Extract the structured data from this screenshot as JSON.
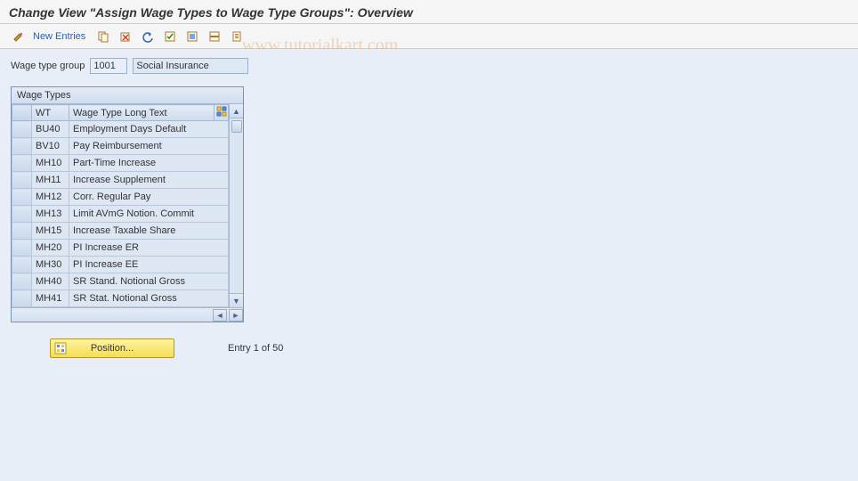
{
  "title": "Change View \"Assign Wage Types to Wage Type Groups\": Overview",
  "toolbar": {
    "new_entries": "New Entries"
  },
  "form": {
    "wage_type_group_label": "Wage type group",
    "wage_type_group_code": "1001",
    "wage_type_group_text": "Social Insurance"
  },
  "table": {
    "title": "Wage Types",
    "col_wt": "WT",
    "col_longtext": "Wage Type Long Text",
    "rows": [
      {
        "wt": "BU40",
        "text": "Employment Days Default"
      },
      {
        "wt": "BV10",
        "text": "Pay Reimbursement"
      },
      {
        "wt": "MH10",
        "text": "Part-Time Increase"
      },
      {
        "wt": "MH11",
        "text": "Increase Supplement"
      },
      {
        "wt": "MH12",
        "text": "Corr. Regular Pay"
      },
      {
        "wt": "MH13",
        "text": "Limit AVmG Notion. Commit"
      },
      {
        "wt": "MH15",
        "text": "Increase Taxable Share"
      },
      {
        "wt": "MH20",
        "text": "PI Increase ER"
      },
      {
        "wt": "MH30",
        "text": "PI Increase EE"
      },
      {
        "wt": "MH40",
        "text": "SR Stand. Notional Gross"
      },
      {
        "wt": "MH41",
        "text": "SR Stat. Notional Gross"
      }
    ]
  },
  "footer": {
    "position_label": "Position...",
    "entry_label": "Entry 1 of 50"
  },
  "watermark": "www.tutorialkart.com"
}
